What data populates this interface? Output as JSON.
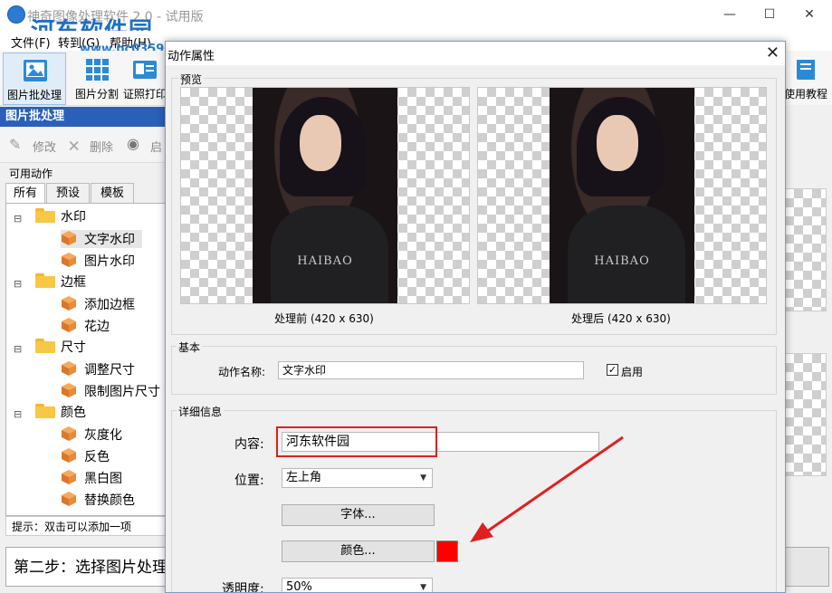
{
  "app": {
    "title": "神奇图像处理软件 2.0 - 试用版",
    "watermark_logo": "河东软件园",
    "watermark_url": "www.pc0359.cn",
    "window_buttons": [
      "—",
      "☐",
      "✕"
    ]
  },
  "menu": [
    "文件(F)",
    "转到(G)",
    "帮助(H)"
  ],
  "toolbar": {
    "items": [
      "图片批处理",
      "图片分割",
      "证照打印"
    ],
    "right_item": "使用教程"
  },
  "panel": {
    "header": "图片批处理",
    "edit_buttons": [
      "修改",
      "删除",
      "启"
    ],
    "actions_label": "可用动作",
    "tabs": [
      "所有",
      "预设",
      "模板"
    ],
    "tree": [
      {
        "label": "水印",
        "children": [
          "文字水印",
          "图片水印"
        ]
      },
      {
        "label": "边框",
        "children": [
          "添加边框",
          "花边"
        ]
      },
      {
        "label": "尺寸",
        "children": [
          "调整尺寸",
          "限制图片尺寸"
        ]
      },
      {
        "label": "颜色",
        "children": [
          "灰度化",
          "反色",
          "黑白图",
          "替换颜色"
        ]
      }
    ],
    "hint": "提示：双击可以添加一项",
    "step": "第二步：选择图片处理"
  },
  "dialog": {
    "title": "动作属性",
    "preview_label": "预览",
    "preview_watermark": "HAIBAO",
    "before_caption": "处理前 (420 x 630)",
    "after_caption": "处理后 (420 x 630)",
    "basic_label": "基本",
    "action_name_label": "动作名称:",
    "action_name_value": "文字水印",
    "enabled_label": "启用",
    "enabled": true,
    "details_label": "详细信息",
    "content_label": "内容:",
    "content_value": "河东软件园",
    "position_label": "位置:",
    "position_value": "左上角",
    "font_button": "字体...",
    "color_button": "颜色...",
    "color_value": "#ff0000",
    "opacity_label": "透明度:",
    "opacity_value": "50%"
  },
  "colors": {
    "header_blue": "#2a60b8",
    "highlight_red": "#e02020",
    "arrow_red": "#e02020",
    "logo_blue": "#1f6fc4"
  }
}
